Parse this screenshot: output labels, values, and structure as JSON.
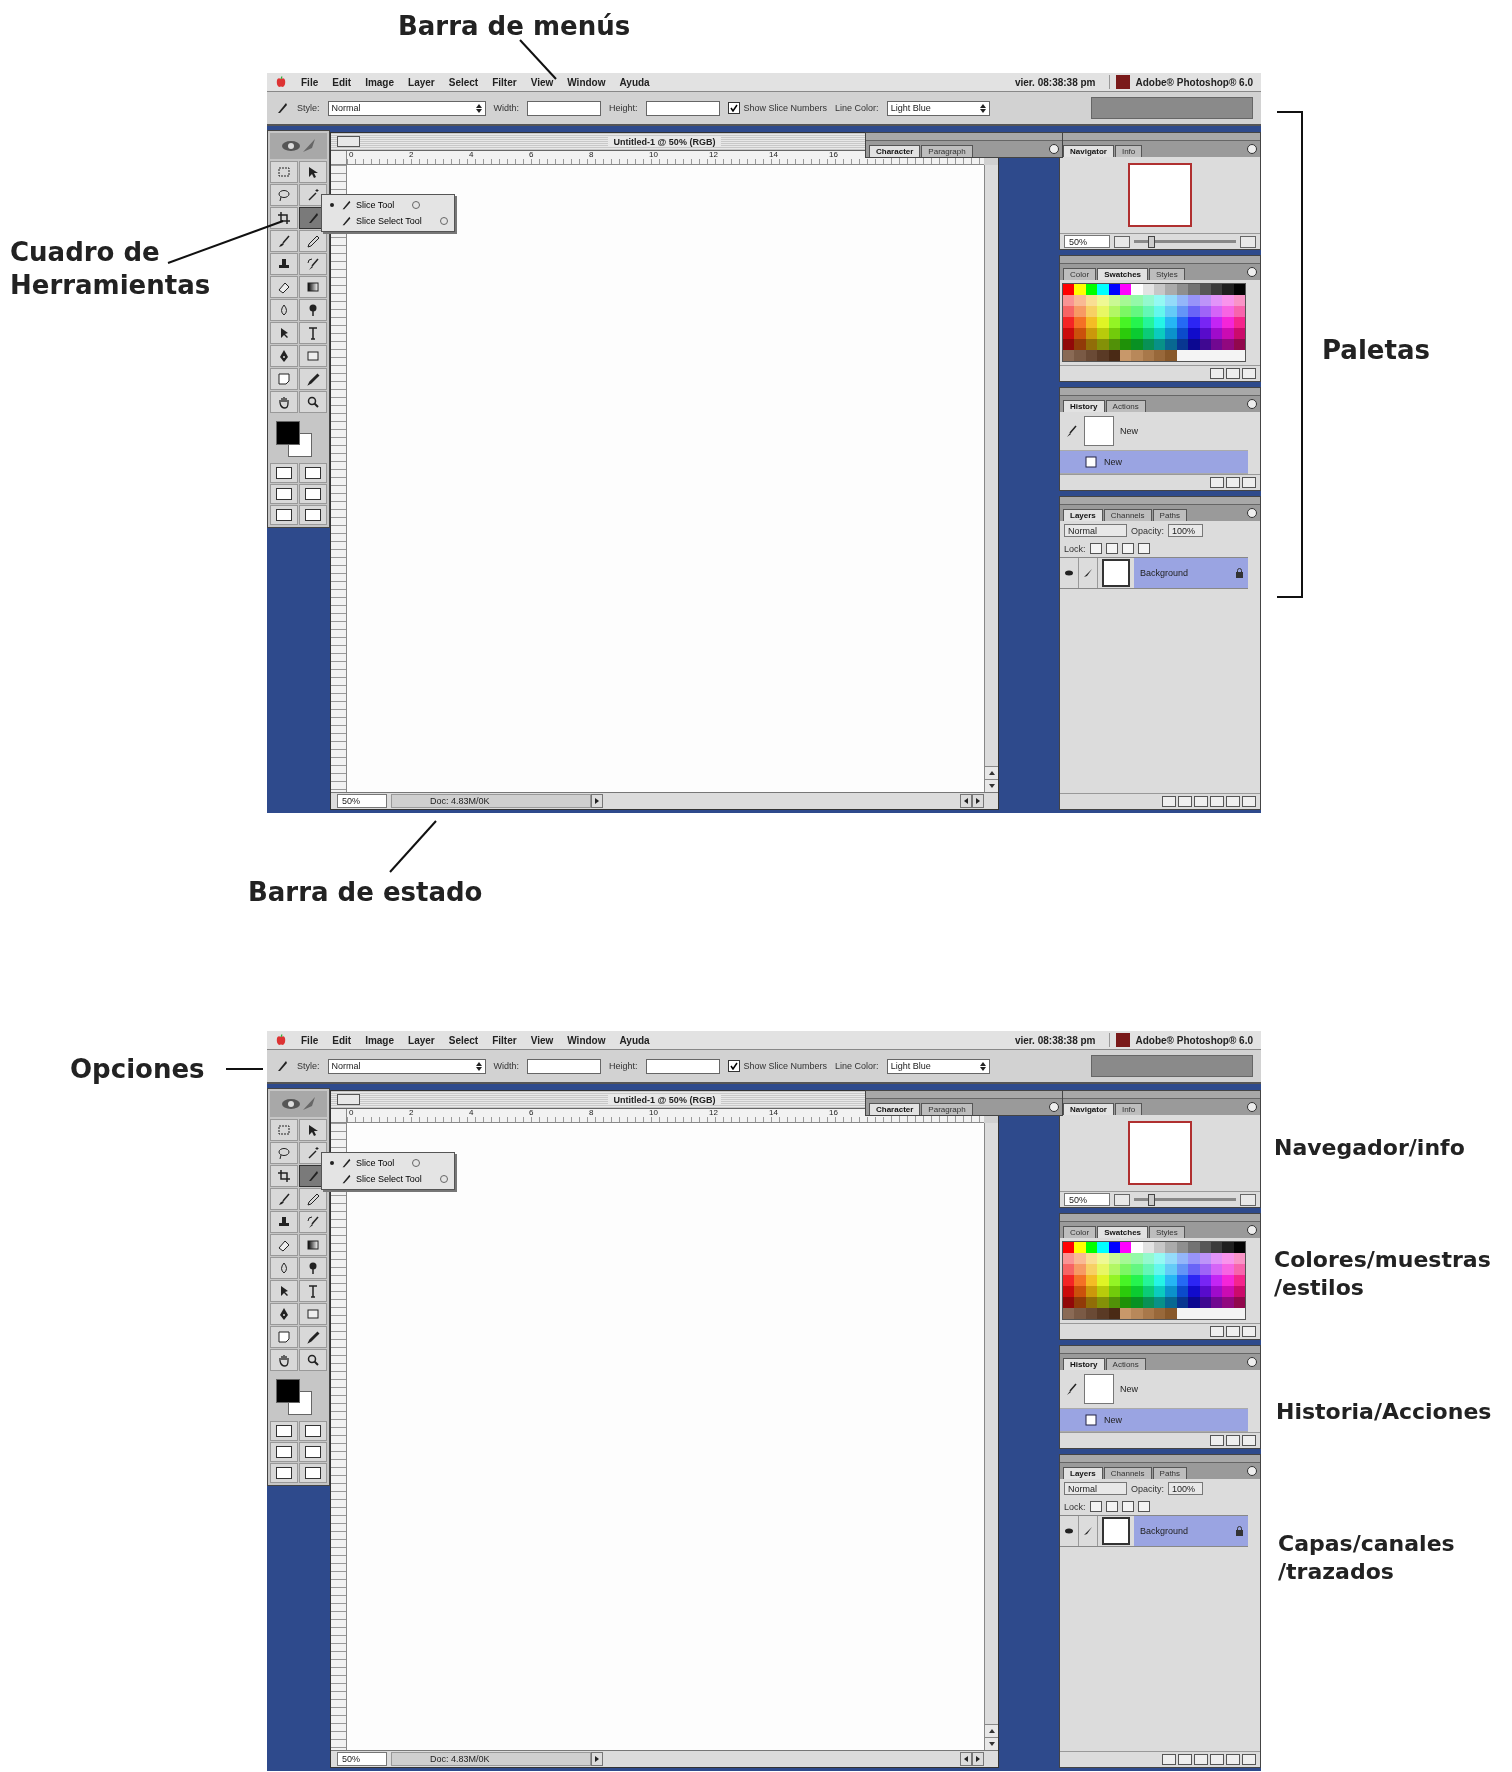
{
  "figures": [
    {
      "screen": {
        "menu_bar": {
          "items": [
            "File",
            "Edit",
            "Image",
            "Layer",
            "Select",
            "Filter",
            "View",
            "Window",
            "Ayuda"
          ],
          "clock": "vier. 08:38:38 pm",
          "app_name": "Adobe® Photoshop® 6.0"
        },
        "options_bar": {
          "style_label": "Style:",
          "style_value": "Normal",
          "width_label": "Width:",
          "height_label": "Height:",
          "show_slice_numbers": {
            "label": "Show Slice Numbers",
            "checked": true
          },
          "line_color_label": "Line Color:",
          "line_color_value": "Light Blue"
        },
        "toolbox": {
          "tools": [
            {
              "selected": false
            },
            {
              "selected": false
            },
            {
              "selected": false
            },
            {
              "selected": false
            },
            {
              "selected": false
            },
            {
              "selected": true
            },
            {
              "selected": false
            },
            {
              "selected": false
            },
            {
              "selected": false
            },
            {
              "selected": false
            },
            {
              "selected": false
            },
            {
              "selected": false
            },
            {
              "selected": false
            },
            {
              "selected": false
            },
            {
              "selected": false
            },
            {
              "selected": false
            },
            {
              "selected": false
            },
            {
              "selected": false
            },
            {
              "selected": false
            },
            {
              "selected": false
            },
            {
              "selected": false
            },
            {
              "selected": false
            }
          ],
          "flyout": [
            {
              "label": "Slice Tool",
              "selected": true
            },
            {
              "label": "Slice Select Tool",
              "selected": false
            }
          ]
        },
        "document": {
          "title": "Untitled-1 @ 50% (RGB)",
          "ruler_marks": [
            "0",
            "2",
            "4",
            "6",
            "8",
            "10",
            "12",
            "14",
            "16"
          ],
          "zoom": "50%",
          "doc_info": "Doc: 4.83M/0K"
        },
        "character_palette": {
          "tabs": [
            {
              "label": "Character",
              "selected": true
            },
            {
              "label": "Paragraph",
              "selected": false
            }
          ]
        },
        "navigator": {
          "tabs": [
            {
              "label": "Navigator",
              "selected": true
            },
            {
              "label": "Info",
              "selected": false
            }
          ],
          "zoom": "50%",
          "zoom_slider": {
            "level": 0.15
          }
        },
        "swatches": {
          "tabs": [
            {
              "label": "Color",
              "selected": false
            },
            {
              "label": "Swatches",
              "selected": true
            },
            {
              "label": "Styles",
              "selected": false
            }
          ]
        },
        "history": {
          "tabs": [
            {
              "label": "History",
              "selected": true
            },
            {
              "label": "Actions",
              "selected": false
            }
          ],
          "items": [
            {
              "label": "New",
              "kind": "snapshot",
              "selected": false
            },
            {
              "label": "New",
              "kind": "state",
              "selected": true
            }
          ]
        },
        "layers": {
          "tabs": [
            {
              "label": "Layers",
              "selected": true
            },
            {
              "label": "Channels",
              "selected": false
            },
            {
              "label": "Paths",
              "selected": false
            }
          ],
          "blend_mode": "Normal",
          "opacity_label": "Opacity:",
          "opacity": "100%",
          "lock_label": "Lock:",
          "locks": [
            {
              "checked": false
            },
            {
              "checked": false
            },
            {
              "checked": false
            },
            {
              "checked": false
            }
          ],
          "items": [
            {
              "name": "Background",
              "selected": true
            }
          ]
        }
      },
      "callouts": [
        {
          "text": "Barra de menús",
          "kind": "leader"
        },
        {
          "text": "Cuadro de Herramientas",
          "kind": "leader"
        },
        {
          "text": "Paletas",
          "kind": "bracket"
        },
        {
          "text": "Barra de estado",
          "kind": "leader"
        }
      ]
    },
    {
      "screen": {
        "menu_bar": {
          "items": [
            "File",
            "Edit",
            "Image",
            "Layer",
            "Select",
            "Filter",
            "View",
            "Window",
            "Ayuda"
          ],
          "clock": "vier. 08:38:38 pm",
          "app_name": "Adobe® Photoshop® 6.0"
        },
        "options_bar": {
          "style_label": "Style:",
          "style_value": "Normal",
          "width_label": "Width:",
          "height_label": "Height:",
          "show_slice_numbers": {
            "label": "Show Slice Numbers",
            "checked": true
          },
          "line_color_label": "Line Color:",
          "line_color_value": "Light Blue"
        },
        "toolbox": {
          "tools": [
            {
              "selected": false
            },
            {
              "selected": false
            },
            {
              "selected": false
            },
            {
              "selected": false
            },
            {
              "selected": false
            },
            {
              "selected": true
            },
            {
              "selected": false
            },
            {
              "selected": false
            },
            {
              "selected": false
            },
            {
              "selected": false
            },
            {
              "selected": false
            },
            {
              "selected": false
            },
            {
              "selected": false
            },
            {
              "selected": false
            },
            {
              "selected": false
            },
            {
              "selected": false
            },
            {
              "selected": false
            },
            {
              "selected": false
            },
            {
              "selected": false
            },
            {
              "selected": false
            },
            {
              "selected": false
            },
            {
              "selected": false
            }
          ],
          "flyout": [
            {
              "label": "Slice Tool",
              "selected": true
            },
            {
              "label": "Slice Select Tool",
              "selected": false
            }
          ]
        },
        "document": {
          "title": "Untitled-1 @ 50% (RGB)",
          "ruler_marks": [
            "0",
            "2",
            "4",
            "6",
            "8",
            "10",
            "12",
            "14",
            "16"
          ],
          "zoom": "50%",
          "doc_info": "Doc: 4.83M/0K"
        },
        "character_palette": {
          "tabs": [
            {
              "label": "Character",
              "selected": true
            },
            {
              "label": "Paragraph",
              "selected": false
            }
          ]
        },
        "navigator": {
          "tabs": [
            {
              "label": "Navigator",
              "selected": true
            },
            {
              "label": "Info",
              "selected": false
            }
          ],
          "zoom": "50%",
          "zoom_slider": {
            "level": 0.15
          }
        },
        "swatches": {
          "tabs": [
            {
              "label": "Color",
              "selected": false
            },
            {
              "label": "Swatches",
              "selected": true
            },
            {
              "label": "Styles",
              "selected": false
            }
          ]
        },
        "history": {
          "tabs": [
            {
              "label": "History",
              "selected": true
            },
            {
              "label": "Actions",
              "selected": false
            }
          ],
          "items": [
            {
              "label": "New",
              "kind": "snapshot",
              "selected": false
            },
            {
              "label": "New",
              "kind": "state",
              "selected": true
            }
          ]
        },
        "layers": {
          "tabs": [
            {
              "label": "Layers",
              "selected": true
            },
            {
              "label": "Channels",
              "selected": false
            },
            {
              "label": "Paths",
              "selected": false
            }
          ],
          "blend_mode": "Normal",
          "opacity_label": "Opacity:",
          "opacity": "100%",
          "lock_label": "Lock:",
          "locks": [
            {
              "checked": false
            },
            {
              "checked": false
            },
            {
              "checked": false
            },
            {
              "checked": false
            }
          ],
          "items": [
            {
              "name": "Background",
              "selected": true
            }
          ]
        }
      },
      "callouts": [
        {
          "text": "Opciones",
          "kind": "leader"
        },
        {
          "text": "Navegador/info",
          "kind": "plain"
        },
        {
          "text": "Colores/muestras /estilos",
          "kind": "plain"
        },
        {
          "text": "Historia/Acciones",
          "kind": "plain"
        },
        {
          "text": "Capas/canales /trazados",
          "kind": "plain"
        }
      ]
    }
  ]
}
